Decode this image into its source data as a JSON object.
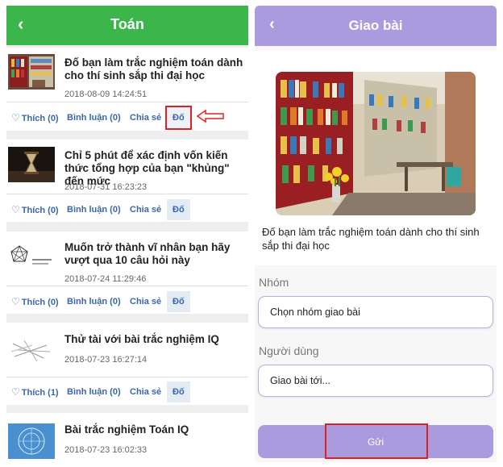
{
  "left": {
    "header": {
      "title": "Toán"
    },
    "items": [
      {
        "title": "Đố bạn làm trắc nghiệm toán dành cho thí sinh sắp thi đại học",
        "date": "2018-08-09 14:24:51",
        "like": "Thích (0)",
        "comment": "Bình luận (0)",
        "share": "Chia sẻ",
        "challenge": "Đố"
      },
      {
        "title": "Chỉ 5 phút để xác định vốn kiến thức tổng hợp của bạn \"khủng\" đến mức",
        "date": "2018-07-31 16:23:23",
        "like": "Thích (0)",
        "comment": "Bình luận (0)",
        "share": "Chia sẻ",
        "challenge": "Đố"
      },
      {
        "title": "Muốn trở thành vĩ nhân bạn hãy vượt qua 10 câu hỏi này",
        "date": "2018-07-24 11:29:46",
        "like": "Thích (0)",
        "comment": "Bình luận (0)",
        "share": "Chia sẻ",
        "challenge": "Đố"
      },
      {
        "title": "Thử tài với bài trắc nghiệm IQ",
        "date": "2018-07-23 16:27:14",
        "like": "Thích (1)",
        "comment": "Bình luận (0)",
        "share": "Chia sẻ",
        "challenge": "Đố"
      },
      {
        "title": "Bài trắc nghiệm Toán IQ",
        "date": "2018-07-23 16:02:33"
      }
    ]
  },
  "right": {
    "header": {
      "title": "Giao bài"
    },
    "quiz_title": "Đố bạn làm trắc nghiệm toán dành cho thí sinh sắp thi đại học",
    "group_label": "Nhóm",
    "group_placeholder": "Chọn nhóm giao bài",
    "user_label": "Người dùng",
    "user_placeholder": "Giao bài tới...",
    "send_label": "Gửi"
  },
  "colors": {
    "left_header": "#3cb54a",
    "right_header": "#a99bde",
    "link": "#3b66a8",
    "highlight": "#e02020"
  }
}
